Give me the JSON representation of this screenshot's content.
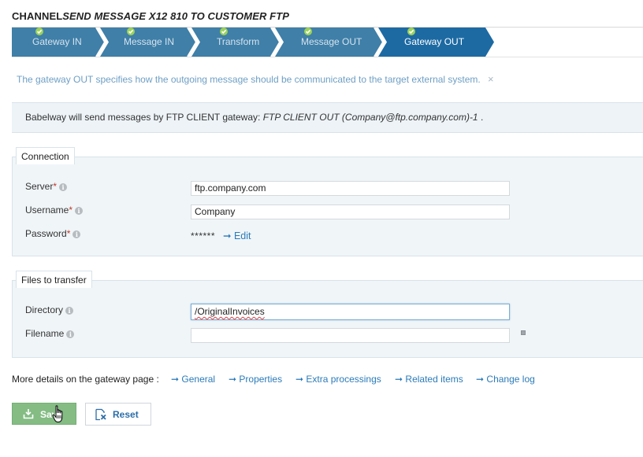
{
  "title": {
    "prefix": "CHANNEL",
    "name": "SEND MESSAGE X12 810 TO CUSTOMER FTP"
  },
  "steps": [
    {
      "label": "Gateway IN",
      "done": true,
      "active": false
    },
    {
      "label": "Message IN",
      "done": true,
      "active": false
    },
    {
      "label": "Transform",
      "done": true,
      "active": false
    },
    {
      "label": "Message OUT",
      "done": true,
      "active": false
    },
    {
      "label": "Gateway OUT",
      "done": true,
      "active": true
    }
  ],
  "info": {
    "text": "The gateway OUT specifies how the outgoing message should be communicated to the target external system.",
    "close": "×"
  },
  "notice": {
    "prefix": "Babelway will send messages by FTP CLIENT gateway:",
    "gateway": "FTP CLIENT OUT (Company@ftp.company.com)-1",
    "suffix": "."
  },
  "connection": {
    "legend": "Connection",
    "server": {
      "label": "Server",
      "value": "ftp.company.com"
    },
    "username": {
      "label": "Username",
      "value": "Company"
    },
    "password": {
      "label": "Password",
      "value": "******",
      "edit": "Edit"
    }
  },
  "files": {
    "legend": "Files to transfer",
    "directory": {
      "label": "Directory",
      "value": "/OriginalInvoices"
    },
    "filename": {
      "label": "Filename",
      "value": ""
    }
  },
  "details": {
    "label": "More details on the gateway page :",
    "links": [
      "General",
      "Properties",
      "Extra processings",
      "Related items",
      "Change log"
    ]
  },
  "buttons": {
    "save": "Save",
    "reset": "Reset"
  },
  "colors": {
    "step_bg": "#3f7fa8",
    "step_active_bg": "#1d6aa3",
    "accent": "#2b7bb9",
    "check": "#9bd25b",
    "save_bg": "#84bc84"
  }
}
